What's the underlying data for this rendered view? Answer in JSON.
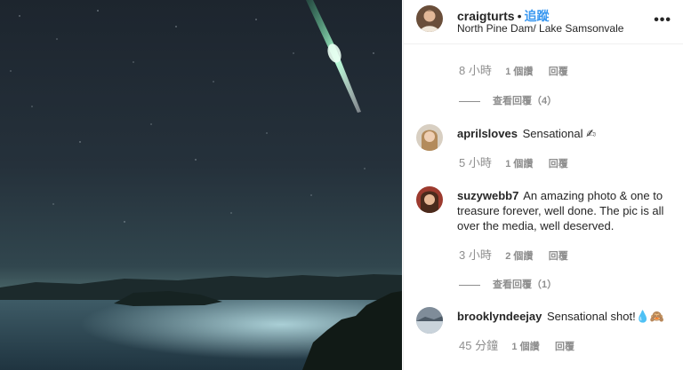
{
  "post": {
    "username": "craigturts",
    "separator": "•",
    "follow_label": "追蹤",
    "location": "North Pine Dam/ Lake Samsonvale",
    "more_icon": "more-options-icon"
  },
  "first_comment_meta": {
    "time": "8 小時",
    "likes": "1 個讚",
    "reply": "回覆",
    "view_replies": "查看回覆（4）"
  },
  "comments": [
    {
      "username": "aprilsloves",
      "text": "Sensational ✍",
      "time": "5 小時",
      "likes": "1 個讚",
      "reply": "回覆"
    },
    {
      "username": "suzywebb7",
      "text": "An amazing photo & one to treasure forever, well done. The pic is all over the media, well deserved.",
      "time": "3 小時",
      "likes": "2 個讚",
      "reply": "回覆",
      "view_replies": "查看回覆（1）"
    },
    {
      "username": "brooklyndeejay",
      "text": "Sensational shot!💧🙈",
      "time": "45 分鐘",
      "likes": "1 個讚",
      "reply": "回覆"
    }
  ],
  "colors": {
    "link_blue": "#3897f0",
    "muted_gray": "#8e8e8e",
    "text_dark": "#262626",
    "sky_dark": "#1f2a35",
    "meteor_green": "#aef5d0"
  }
}
